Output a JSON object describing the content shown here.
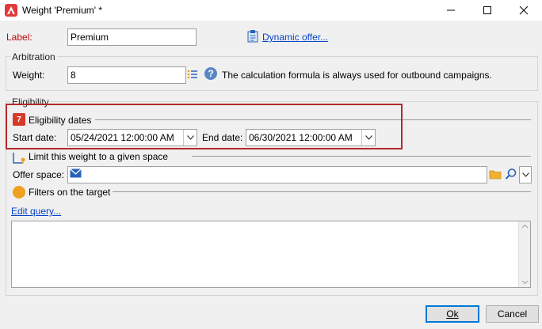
{
  "window": {
    "title": "Weight 'Premium' *",
    "minimize_icon": "minimize-icon",
    "maximize_icon": "maximize-icon",
    "close_icon": "close-icon"
  },
  "label_field": {
    "label": "Label:",
    "value": "Premium"
  },
  "dynamic_offer_link": "Dynamic offer...",
  "arbitration": {
    "group_title": "Arbitration",
    "weight_label": "Weight:",
    "weight_value": "8",
    "info_text": "The calculation formula is always used for outbound campaigns."
  },
  "eligibility": {
    "group_title": "Eligibility",
    "dates_section_title": "Eligibility dates",
    "start_label": "Start date:",
    "start_value": "05/24/2021 12:00:00 AM",
    "end_label": "End date:",
    "end_value": "06/30/2021 12:00:00 AM",
    "calendar_icon_number": "7"
  },
  "space": {
    "section_title": "Limit this weight to a given space",
    "offer_space_label": "Offer space:",
    "offer_space_value": ""
  },
  "filters": {
    "section_title": "Filters on the target",
    "edit_query_link": "Edit query...",
    "query_text": ""
  },
  "buttons": {
    "ok": "Ok",
    "cancel": "Cancel"
  },
  "colors": {
    "highlight_border": "#b22a2a",
    "label_required": "#c00000",
    "link": "#0645c8",
    "filter_dot": "#f0a020"
  }
}
